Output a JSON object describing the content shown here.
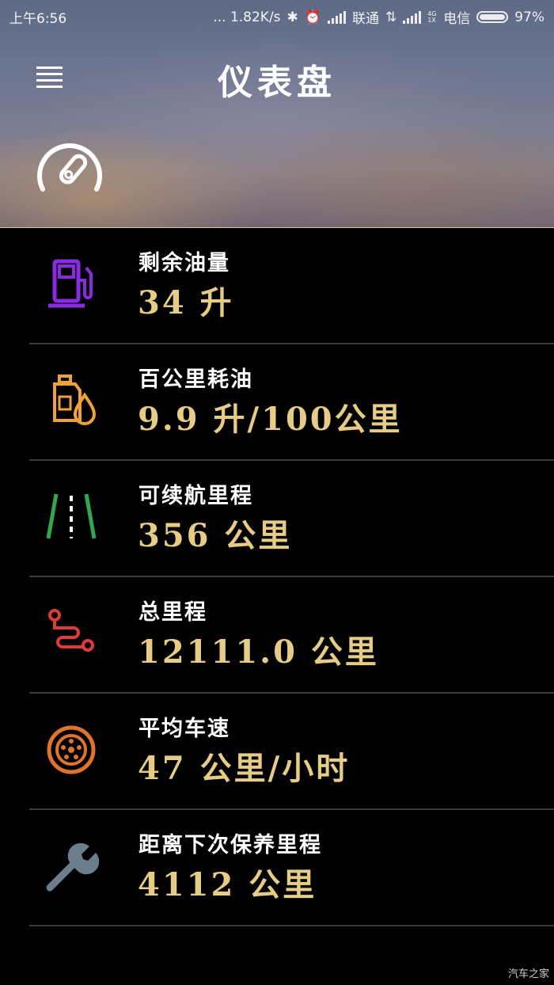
{
  "status_bar": {
    "time": "上午6:56",
    "network_speed": "... 1.82K/s",
    "carrier1": "联通",
    "carrier2": "电信",
    "network_type": "4G 1X",
    "battery": "97%"
  },
  "header": {
    "title": "仪表盘",
    "menu_icon": "hamburger-menu-icon",
    "gauge_icon": "speedometer-icon"
  },
  "items": [
    {
      "label": "剩余油量",
      "value": "34 升",
      "icon": "fuel-pump-icon",
      "color": "#8a2be2"
    },
    {
      "label": "百公里耗油",
      "value": "9.9 升/100公里",
      "icon": "oil-can-drop-icon",
      "color": "#f0a23a"
    },
    {
      "label": "可续航里程",
      "value": "356 公里",
      "icon": "road-lanes-icon",
      "color": "#2fa84f"
    },
    {
      "label": "总里程",
      "value": "12111.0 公里",
      "icon": "route-path-icon",
      "color": "#e03b3b"
    },
    {
      "label": "平均车速",
      "value": "47 公里/小时",
      "icon": "wheel-icon",
      "color": "#e0742a"
    },
    {
      "label": "距离下次保养里程",
      "value": "4112 公里",
      "icon": "wrench-icon",
      "color": "#6d7d8c"
    }
  ],
  "colors": {
    "value_text": "#e6cc84",
    "divider": "#3a3a3a"
  },
  "watermark": "汽车之家"
}
